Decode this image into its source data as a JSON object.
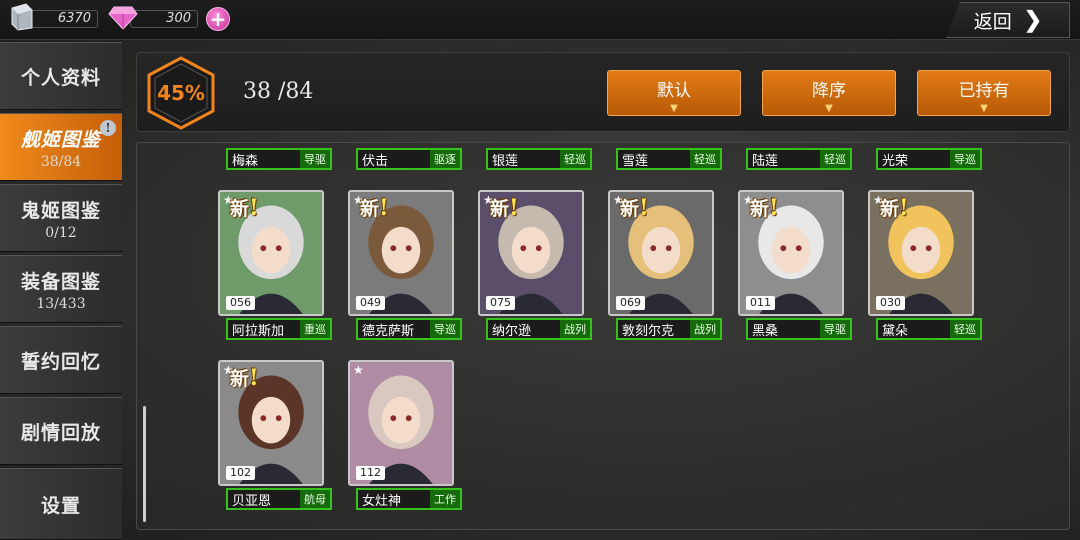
{
  "topbar": {
    "steel_amount": "6370",
    "gem_amount": "300",
    "back_label": "返回"
  },
  "sidebar": {
    "items": [
      {
        "label": "个人资料",
        "sub": ""
      },
      {
        "label": "舰姬图鉴",
        "sub": "38/84"
      },
      {
        "label": "鬼姬图鉴",
        "sub": "0/12"
      },
      {
        "label": "装备图鉴",
        "sub": "13/433"
      },
      {
        "label": "誓约回忆",
        "sub": ""
      },
      {
        "label": "剧情回放",
        "sub": ""
      },
      {
        "label": "设置",
        "sub": ""
      }
    ]
  },
  "header": {
    "progress_label": "45%",
    "progress_value": 0.45,
    "count_label": "38 /84",
    "filters": [
      "默认",
      "降序",
      "已持有"
    ]
  },
  "colors": {
    "accent_orange": "#e27b17",
    "type_green": "#35c21c",
    "progress_hex": "#f2841d"
  },
  "ships_row1_names": [
    {
      "name": "梅森",
      "type": "导驱"
    },
    {
      "name": "伏击",
      "type": "驱逐"
    },
    {
      "name": "银莲",
      "type": "轻巡"
    },
    {
      "name": "雪莲",
      "type": "轻巡"
    },
    {
      "name": "陆莲",
      "type": "轻巡"
    },
    {
      "name": "光荣",
      "type": "导巡"
    }
  ],
  "cards": [
    {
      "num": "056",
      "name": "阿拉斯加",
      "type": "重巡",
      "new": "新",
      "hair": "#d9d9d9",
      "bg": "#6f9a6a"
    },
    {
      "num": "049",
      "name": "德克萨斯",
      "type": "导巡",
      "new": "新",
      "hair": "#7b5a3c",
      "bg": "#7b7b7b"
    },
    {
      "num": "075",
      "name": "纳尔逊",
      "type": "战列",
      "new": "新",
      "hair": "#c6b9ae",
      "bg": "#5a4e6a"
    },
    {
      "num": "069",
      "name": "敦刻尔克",
      "type": "战列",
      "new": "新",
      "hair": "#e4c07a",
      "bg": "#6a6a6a"
    },
    {
      "num": "011",
      "name": "黑桑",
      "type": "导驱",
      "new": "新",
      "hair": "#e8e8e8",
      "bg": "#8e8e8e"
    },
    {
      "num": "030",
      "name": "黛朵",
      "type": "轻巡",
      "new": "新",
      "hair": "#f0c35c",
      "bg": "#7a7060"
    },
    {
      "num": "102",
      "name": "贝亚恩",
      "type": "航母",
      "new": "新",
      "hair": "#5a3528",
      "bg": "#8a8a8a"
    },
    {
      "num": "112",
      "name": "女灶神",
      "type": "工作",
      "new": "",
      "hair": "#d8c8c0",
      "bg": "#b08ca4"
    }
  ]
}
